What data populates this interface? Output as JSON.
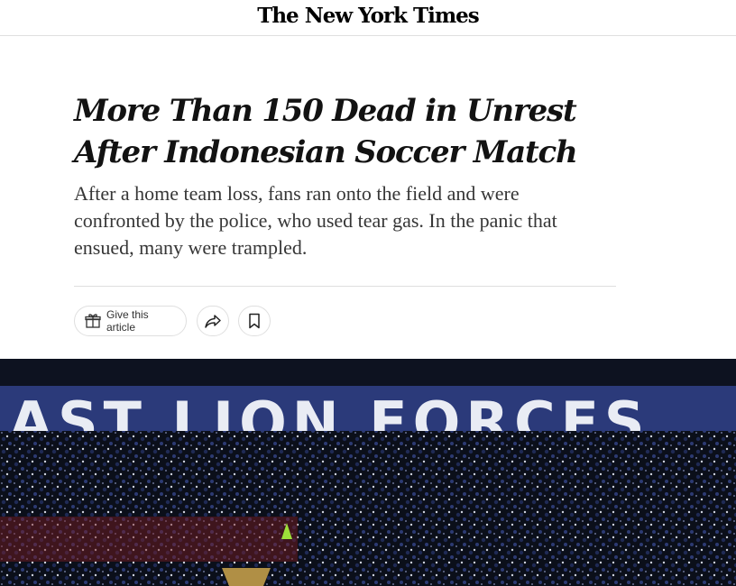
{
  "masthead": {
    "logo_text": "The New York Times"
  },
  "article": {
    "headline": "More Than 150 Dead in Unrest After Indonesian Soccer Match",
    "summary": "After a home team loss, fans ran onto the field and were confronted by the police, who used tear gas. In the panic that ensued, many were trampled."
  },
  "tools": {
    "gift_label": "Give this article",
    "icons": [
      "gift-icon",
      "share-icon",
      "bookmark-icon"
    ]
  },
  "photo": {
    "banner_text": "AST LION FORCES",
    "colors": {
      "banner": "#2b3a7a",
      "crowd": "#0b0f1a",
      "fence": "#7a1c22"
    }
  }
}
